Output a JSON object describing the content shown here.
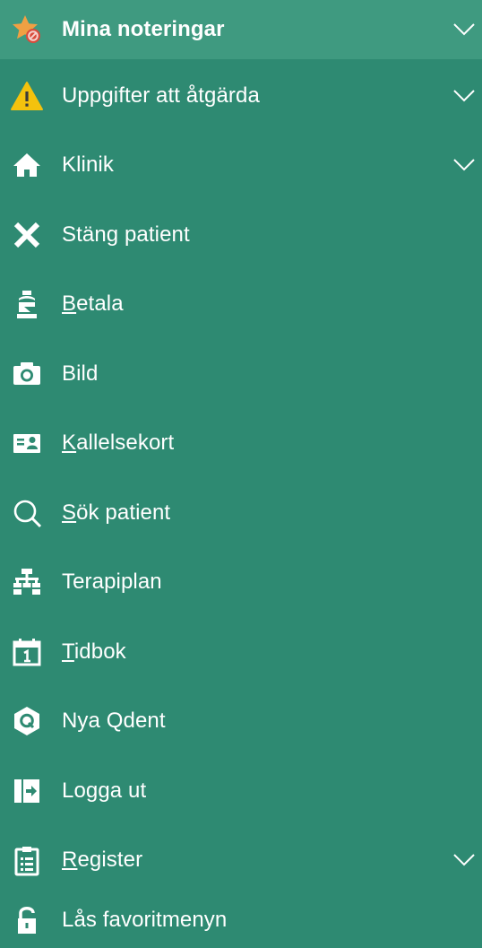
{
  "menu": {
    "items": [
      {
        "id": "mina-noteringar",
        "label": "Mina noteringar",
        "icon": "star-no-icon",
        "expandable": true,
        "bold": true
      },
      {
        "id": "uppgifter",
        "label": "Uppgifter att åtgärda",
        "icon": "warning-icon",
        "expandable": true
      },
      {
        "id": "klinik",
        "label": "Klinik",
        "icon": "home-icon",
        "expandable": true
      },
      {
        "id": "stang-patient",
        "label": "Stäng patient",
        "icon": "close-icon",
        "expandable": false
      },
      {
        "id": "betala",
        "label": "Betala",
        "icon": "payment-icon",
        "expandable": false
      },
      {
        "id": "bild",
        "label": "Bild",
        "icon": "camera-icon",
        "expandable": false
      },
      {
        "id": "kallelsekort",
        "label": "Kallelsekort",
        "icon": "contact-card-icon",
        "expandable": false
      },
      {
        "id": "sok-patient",
        "label": "Sök patient",
        "icon": "search-icon",
        "expandable": false
      },
      {
        "id": "terapiplan",
        "label": "Terapiplan",
        "icon": "hierarchy-icon",
        "expandable": false
      },
      {
        "id": "tidbok",
        "label": "Tidbok",
        "icon": "calendar-icon",
        "expandable": false
      },
      {
        "id": "nya-qdent",
        "label": "Nya Qdent",
        "icon": "q-hexagon-icon",
        "expandable": false
      },
      {
        "id": "logga-ut",
        "label": "Logga ut",
        "icon": "logout-icon",
        "expandable": false
      },
      {
        "id": "register",
        "label": "Register",
        "icon": "clipboard-icon",
        "expandable": true
      },
      {
        "id": "las-favoritmenyn",
        "label": "Lås favoritmenyn",
        "icon": "lock-icon",
        "expandable": false
      }
    ]
  },
  "colors": {
    "background": "#2e8a72",
    "highlight": "#3f9a80",
    "text": "#ffffff",
    "warning": "#f4c20d",
    "star": "#f0a043",
    "badge": "#d94b3b"
  }
}
